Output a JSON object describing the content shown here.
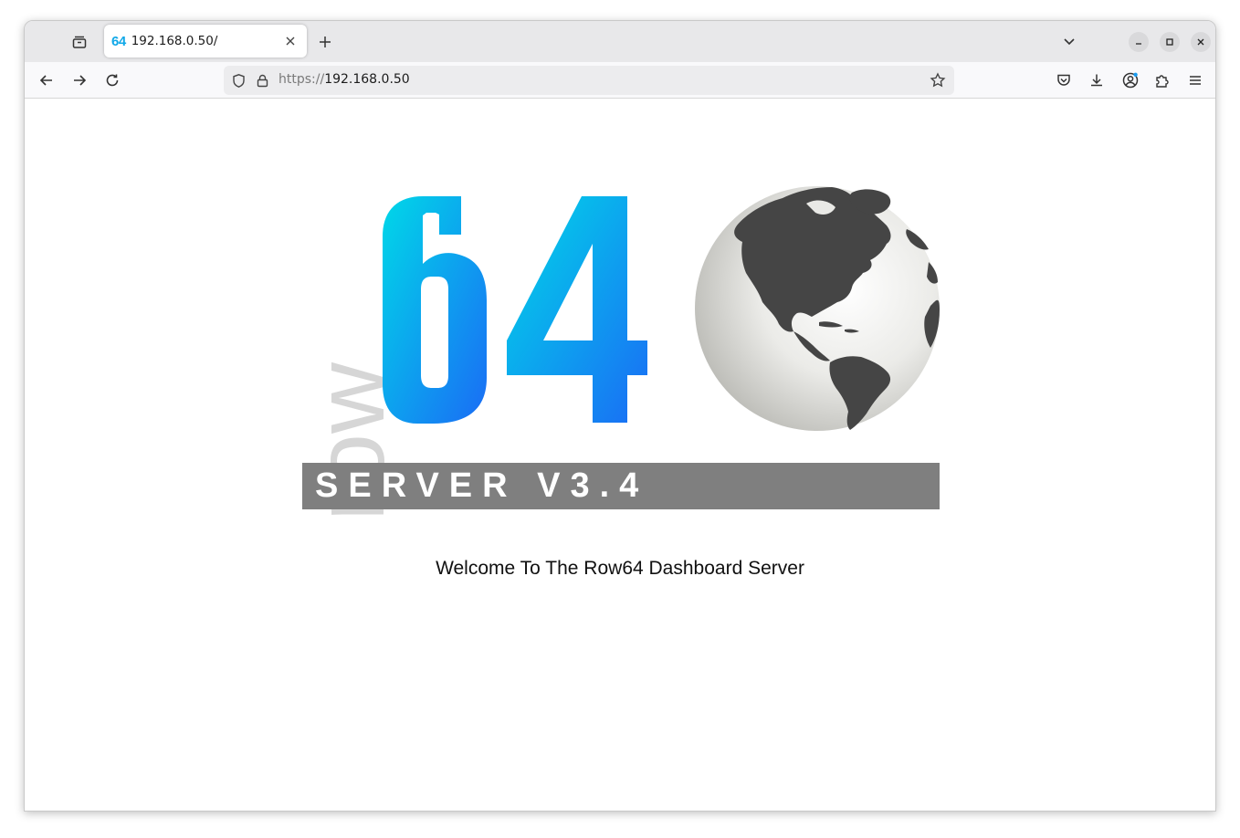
{
  "browser": {
    "tab": {
      "favicon_text": "64",
      "title": "192.168.0.50/"
    },
    "url": {
      "scheme": "https://",
      "host": "192.168.0.50"
    }
  },
  "page": {
    "logo": {
      "word": "row",
      "number": "64",
      "band_text": "SERVER V3.4"
    },
    "welcome_text": "Welcome To The Row64 Dashboard Server"
  },
  "colors": {
    "logo_gradient_start": "#00d8e8",
    "logo_gradient_end": "#1a6cf5",
    "row_text": "#d6d6d6",
    "band": "#7f7f7f",
    "continents": "#454545"
  }
}
